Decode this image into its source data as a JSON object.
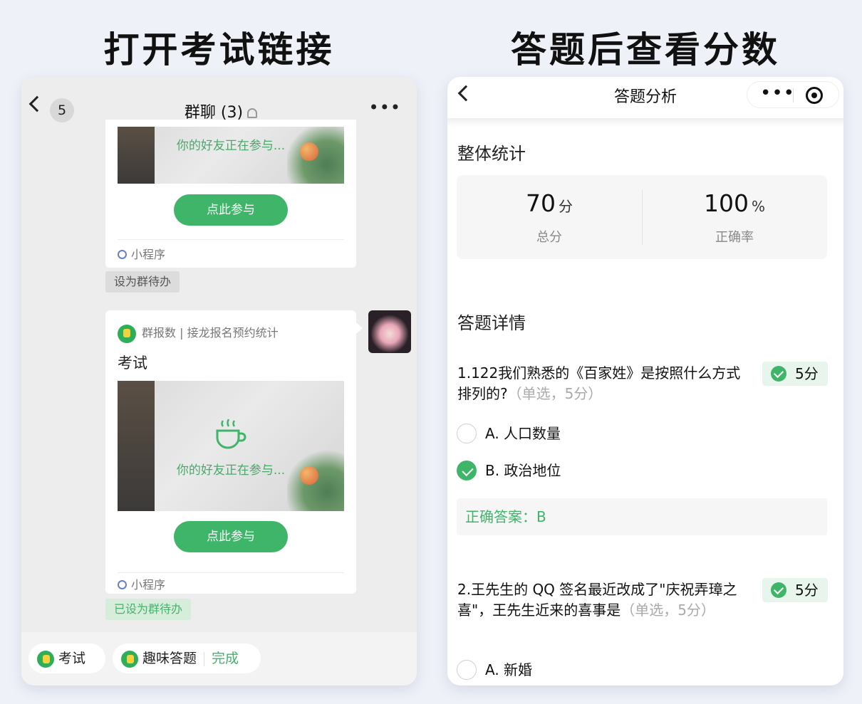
{
  "headings": {
    "left": "打开考试链接",
    "right": "答题后查看分数"
  },
  "left_phone": {
    "unread_count": "5",
    "chat_title": "群聊 (3)",
    "card1": {
      "image_text": "你的好友正在参与...",
      "join_label": "点此参与",
      "mini_program_label": "小程序",
      "todo_label": "设为群待办"
    },
    "card2": {
      "app_line": "群报数 | 接龙报名预约统计",
      "title": "考试",
      "image_text": "你的好友正在参与...",
      "join_label": "点此参与",
      "mini_program_label": "小程序",
      "todo_label": "已设为群待办"
    },
    "bottom_bar": {
      "pill1_label": "考试",
      "pill2_label": "趣味答题",
      "pill2_action": "完成"
    }
  },
  "right_phone": {
    "title": "答题分析",
    "overall_title": "整体统计",
    "stats": {
      "score_value": "70",
      "score_unit": "分",
      "score_label": "总分",
      "rate_value": "100",
      "rate_unit": "%",
      "rate_label": "正确率"
    },
    "detail_title": "答题详情",
    "questions": [
      {
        "text": "1.122我们熟悉的《百家姓》是按照什么方式排列的?",
        "type": "（单选，5分）",
        "score": "5分",
        "options": [
          {
            "label": "A. 人口数量",
            "checked": false
          },
          {
            "label": "B. 政治地位",
            "checked": true
          }
        ],
        "answer": "正确答案：B"
      },
      {
        "text": "2.王先生的 QQ 签名最近改成了\"庆祝弄璋之喜\"，王先生近来的喜事是",
        "type": "（单选，5分）",
        "score": "5分",
        "options": [
          {
            "label": "A. 新婚",
            "checked": false
          }
        ]
      }
    ]
  },
  "colors": {
    "accent_green": "#3fb56a",
    "background": "#eef1f8"
  }
}
